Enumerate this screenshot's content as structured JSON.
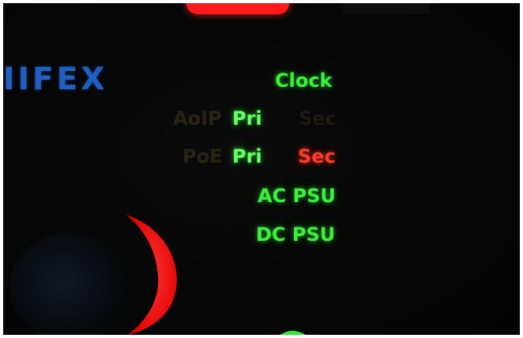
{
  "brand": {
    "text": "IIFEX",
    "color": "#1f5fc2"
  },
  "indicators": {
    "clock": "Clock",
    "aoip_label": "AoIP",
    "aoip_pri": "Pri",
    "aoip_sec": "Sec",
    "poe_label": "PoE",
    "poe_pri": "Pri",
    "poe_sec": "Sec",
    "ac_psu": "AC PSU",
    "dc_psu": "DC PSU"
  },
  "colors": {
    "background": "#060606",
    "led_green": "#3cf03c",
    "led_red": "#ff3a2a",
    "led_off": "#2a2414"
  }
}
